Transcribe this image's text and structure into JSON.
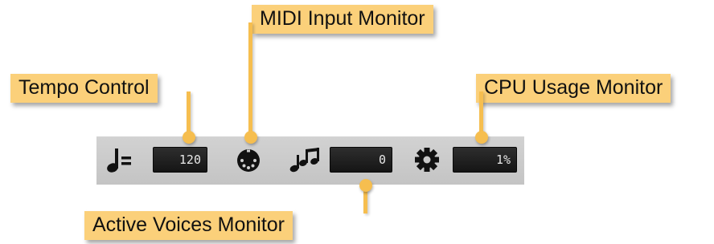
{
  "callouts": {
    "tempo": "Tempo Control",
    "midi": "MIDI Input Monitor",
    "cpu": "CPU Usage Monitor",
    "voices": "Active Voices Monitor"
  },
  "toolbar": {
    "tempo_value": "120",
    "voices_value": "0",
    "cpu_value": "1%"
  },
  "icons": {
    "tempo": "quarter-note-equals-icon",
    "midi": "midi-din-connector-icon",
    "voices": "music-notes-icon",
    "cpu": "gear-icon"
  },
  "colors": {
    "callout": "#fbd07a",
    "leader": "#f6be4f",
    "toolbar": "#cbcbcb",
    "field": "#1c1c1c"
  }
}
